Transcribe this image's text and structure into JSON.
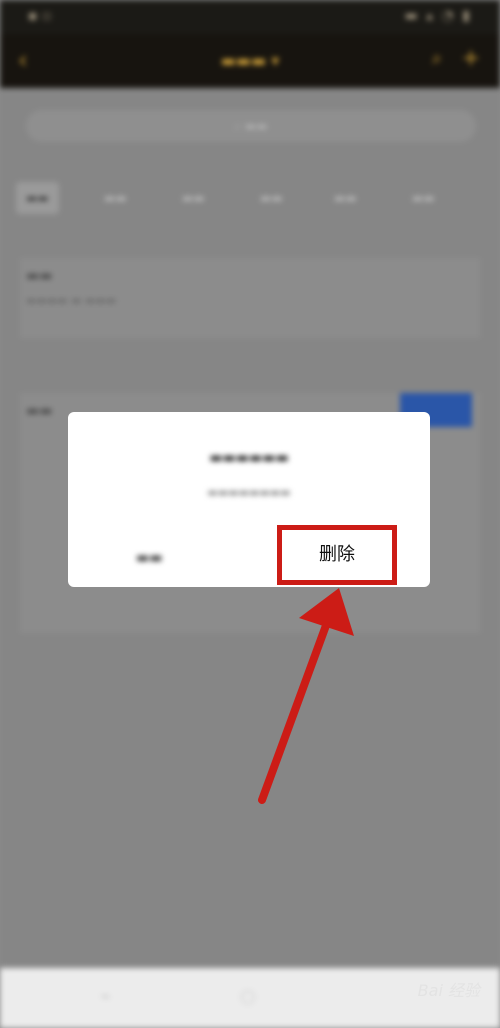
{
  "dialog": {
    "confirm_label": "删除"
  },
  "watermark": {
    "text": "Bai 经验"
  },
  "colors": {
    "annotation_red": "#cc1c16",
    "app_bar_gold": "#c79a37"
  }
}
